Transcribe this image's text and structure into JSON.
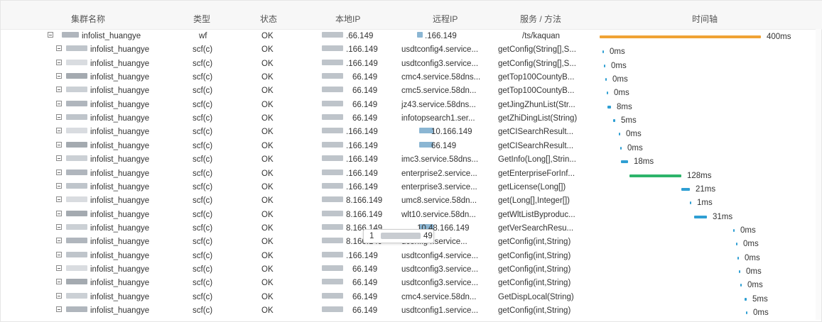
{
  "columns": {
    "cluster": "集群名称",
    "type": "类型",
    "status": "状态",
    "local_ip": "本地IP",
    "remote_ip": "远程IP",
    "service": "服务 / 方法",
    "timeline": "时间轴"
  },
  "colors": {
    "orange": "#f0a335",
    "blue": "#2f9fd3",
    "green": "#2db46b"
  },
  "tooltip": {
    "left": "1",
    "right": "49"
  },
  "rows": [
    {
      "cluster": "infolist_huangye",
      "type": "wf",
      "status": "OK",
      "local_ip": ".66.149",
      "remote_ip": ".166.149",
      "service": "",
      "method": "/ts/kaquan",
      "duration": "400ms",
      "color": "orange",
      "ms": 400
    },
    {
      "cluster": "infolist_huangye",
      "type": "scf(c)",
      "status": "OK",
      "local_ip": ".166.149",
      "remote_ip": "",
      "service": "usdtconfig4.service...",
      "method": "getConfig(String[],S...",
      "duration": "0ms",
      "color": "blue",
      "ms": 0
    },
    {
      "cluster": "infolist_huangye",
      "type": "scf(c)",
      "status": "OK",
      "local_ip": ".166.149",
      "remote_ip": "",
      "service": "usdtconfig3.service...",
      "method": "getConfig(String[],S...",
      "duration": "0ms",
      "color": "blue",
      "ms": 0
    },
    {
      "cluster": "infolist_huangye",
      "type": "scf(c)",
      "status": "OK",
      "local_ip": "66.149",
      "remote_ip": "",
      "service": "cmc4.service.58dns...",
      "method": "getTop100CountyB...",
      "duration": "0ms",
      "color": "blue",
      "ms": 0
    },
    {
      "cluster": "infolist_huangye",
      "type": "scf(c)",
      "status": "OK",
      "local_ip": "66.149",
      "remote_ip": "",
      "service": "cmc5.service.58dn...",
      "method": "getTop100CountyB...",
      "duration": "0ms",
      "color": "blue",
      "ms": 0
    },
    {
      "cluster": "infolist_huangye",
      "type": "scf(c)",
      "status": "OK",
      "local_ip": "66.149",
      "remote_ip": "",
      "service": "jz43.service.58dns...",
      "method": "getJingZhunList(Str...",
      "duration": "8ms",
      "color": "blue",
      "ms": 8
    },
    {
      "cluster": "infolist_huangye",
      "type": "scf(c)",
      "status": "OK",
      "local_ip": "66.149",
      "remote_ip": "",
      "service": "infotopsearch1.ser...",
      "method": "getZhiDingList(String)",
      "duration": "5ms",
      "color": "blue",
      "ms": 5
    },
    {
      "cluster": "infolist_huangye",
      "type": "scf(c)",
      "status": "OK",
      "local_ip": ".166.149",
      "remote_ip": "10.166.149",
      "service": "",
      "method": "getCISearchResult...",
      "duration": "0ms",
      "color": "blue",
      "ms": 0
    },
    {
      "cluster": "infolist_huangye",
      "type": "scf(c)",
      "status": "OK",
      "local_ip": ".166.149",
      "remote_ip": "66.149",
      "service": "",
      "method": "getCISearchResult...",
      "duration": "0ms",
      "color": "blue",
      "ms": 0
    },
    {
      "cluster": "infolist_huangye",
      "type": "scf(c)",
      "status": "OK",
      "local_ip": ".166.149",
      "remote_ip": "",
      "service": "imc3.service.58dns...",
      "method": "GetInfo(Long[],Strin...",
      "duration": "18ms",
      "color": "blue",
      "ms": 18
    },
    {
      "cluster": "infolist_huangye",
      "type": "scf(c)",
      "status": "OK",
      "local_ip": ".166.149",
      "remote_ip": "",
      "service": "enterprise2.service...",
      "method": "getEnterpriseForInf...",
      "duration": "128ms",
      "color": "green",
      "ms": 128
    },
    {
      "cluster": "infolist_huangye",
      "type": "scf(c)",
      "status": "OK",
      "local_ip": ".166.149",
      "remote_ip": "",
      "service": "enterprise3.service...",
      "method": "getLicense(Long[])",
      "duration": "21ms",
      "color": "blue",
      "ms": 21
    },
    {
      "cluster": "infolist_huangye",
      "type": "scf(c)",
      "status": "OK",
      "local_ip": "8.166.149",
      "remote_ip": "",
      "service": "umc8.service.58dn...",
      "method": "get(Long[],Integer[])",
      "duration": "1ms",
      "color": "blue",
      "ms": 1
    },
    {
      "cluster": "infolist_huangye",
      "type": "scf(c)",
      "status": "OK",
      "local_ip": "8.166.149",
      "remote_ip": "",
      "service": "wlt10.service.58dn...",
      "method": "getWltListByproduc...",
      "duration": "31ms",
      "color": "blue",
      "ms": 31
    },
    {
      "cluster": "infolist_huangye",
      "type": "scf(c)",
      "status": "OK",
      "local_ip": "8.166.149",
      "remote_ip": "10.48.166.149",
      "service": "",
      "method": "getVerSearchResu...",
      "duration": "0ms",
      "color": "blue",
      "ms": 0
    },
    {
      "cluster": "infolist_huangye",
      "type": "scf(c)",
      "status": "OK",
      "local_ip": "8.166.149",
      "remote_ip": "",
      "service": "dconfig4.service...",
      "method": "getConfig(int,String)",
      "duration": "0ms",
      "color": "blue",
      "ms": 0
    },
    {
      "cluster": "infolist_huangye",
      "type": "scf(c)",
      "status": "OK",
      "local_ip": ".166.149",
      "remote_ip": "",
      "service": "usdtconfig4.service...",
      "method": "getConfig(int,String)",
      "duration": "0ms",
      "color": "blue",
      "ms": 0
    },
    {
      "cluster": "infolist_huangye",
      "type": "scf(c)",
      "status": "OK",
      "local_ip": "66.149",
      "remote_ip": "",
      "service": "usdtconfig3.service...",
      "method": "getConfig(int,String)",
      "duration": "0ms",
      "color": "blue",
      "ms": 0
    },
    {
      "cluster": "infolist_huangye",
      "type": "scf(c)",
      "status": "OK",
      "local_ip": "66.149",
      "remote_ip": "",
      "service": "usdtconfig3.service...",
      "method": "getConfig(int,String)",
      "duration": "0ms",
      "color": "blue",
      "ms": 0
    },
    {
      "cluster": "infolist_huangye",
      "type": "scf(c)",
      "status": "OK",
      "local_ip": "66.149",
      "remote_ip": "",
      "service": "cmc4.service.58dn...",
      "method": "GetDispLocal(String)",
      "duration": "5ms",
      "color": "blue",
      "ms": 5
    },
    {
      "cluster": "infolist_huangye",
      "type": "scf(c)",
      "status": "OK",
      "local_ip": "66.149",
      "remote_ip": "",
      "service": "usdtconfig1.service...",
      "method": "getConfig(int,String)",
      "duration": "0ms",
      "color": "blue",
      "ms": 0
    }
  ]
}
